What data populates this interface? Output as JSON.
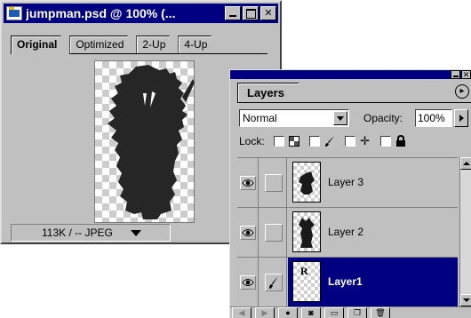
{
  "document_window": {
    "title": "jumpman.psd @ 100% (...",
    "tabs": [
      {
        "label": "Original",
        "active": true
      },
      {
        "label": "Optimized",
        "active": false
      },
      {
        "label": "2-Up",
        "active": false
      },
      {
        "label": "4-Up",
        "active": false
      }
    ],
    "status": "113K / -- JPEG"
  },
  "layers_palette": {
    "tab_label": "Layers",
    "blend_mode": "Normal",
    "opacity_label": "Opacity:",
    "opacity_value": "100%",
    "lock_label": "Lock:",
    "layers": [
      {
        "name": "Layer 3",
        "visible": true,
        "linked_icon": "",
        "selected": false
      },
      {
        "name": "Layer 2",
        "visible": true,
        "linked_icon": "",
        "selected": false
      },
      {
        "name": "Layer1",
        "visible": true,
        "linked_icon": "brush-icon",
        "selected": true
      }
    ],
    "bottom_icons": [
      "prev-icon",
      "next-icon",
      "layer-style-icon",
      "mask-icon",
      "folder-icon",
      "new-layer-icon",
      "trash-icon"
    ]
  },
  "colors": {
    "titlebar": "#000080",
    "selection": "#000080",
    "chrome": "#c0c0c0"
  }
}
